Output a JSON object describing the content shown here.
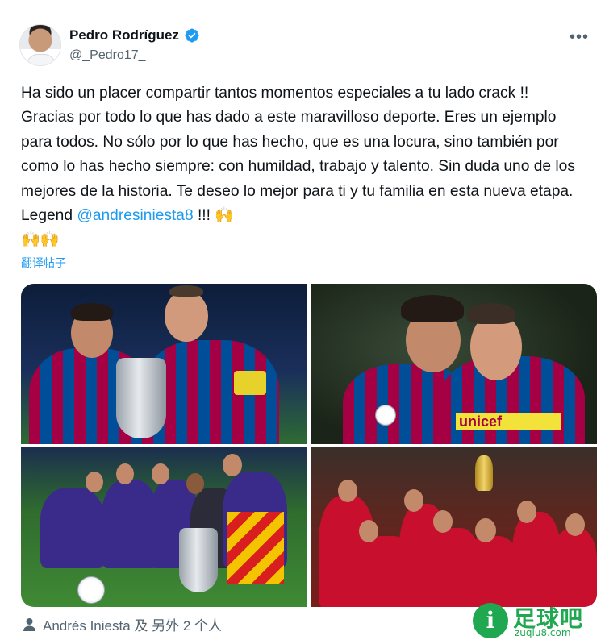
{
  "author": {
    "name": "Pedro Rodríguez",
    "handle": "@_Pedro17_",
    "verified_color": "#1d9bf0"
  },
  "more_icon": "more-horizontal-icon",
  "tweet": {
    "text_before": "Ha sido un placer compartir tantos momentos especiales a tu lado crack !! Gracias por todo lo que has dado a este maravilloso deporte. Eres un ejemplo para todos. No sólo por lo que has hecho, que es una locura, sino también por como lo has hecho siempre: con humildad, trabajo y talento. Sin duda uno de los mejores de la historia. Te deseo lo mejor para ti y tu familia en esta nueva etapa. Legend ",
    "mention": "@andresiniesta8",
    "text_after": " !!! 🙌",
    "emoji_line": "🙌🙌",
    "translate_label": "翻译帖子"
  },
  "media": {
    "photos": [
      {
        "name": "photo-supercup-trophy"
      },
      {
        "name": "photo-embrace"
      },
      {
        "name": "photo-champions-league-celebration"
      },
      {
        "name": "photo-world-cup-celebration"
      }
    ]
  },
  "tagged": {
    "text": "Andrés Iniesta 及 另外 2 个人"
  },
  "watermark": {
    "logo_letter": "i",
    "brand": "足球吧",
    "domain": "zuqiu8.com",
    "color": "#1fa84f"
  },
  "colors": {
    "link": "#1d9bf0",
    "secondary_text": "#536471"
  }
}
